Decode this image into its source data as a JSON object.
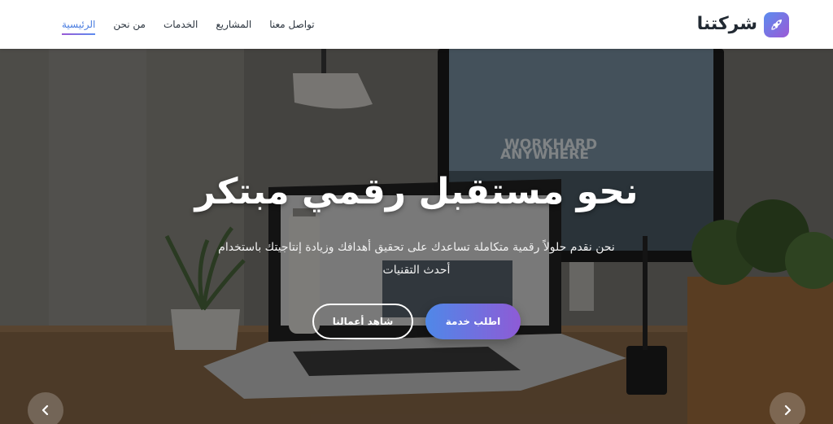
{
  "brand": {
    "name": "شركتنا",
    "logo_icon": "rocket-icon"
  },
  "nav": {
    "items": [
      {
        "label": "الرئيسية",
        "active": true
      },
      {
        "label": "من نحن",
        "active": false
      },
      {
        "label": "الخدمات",
        "active": false
      },
      {
        "label": "المشاريع",
        "active": false
      },
      {
        "label": "تواصل معنا",
        "active": false
      }
    ]
  },
  "hero": {
    "title": "نحو مستقبل رقمي مبتكر",
    "subtitle": "نحن نقدم حلولاً رقمية متكاملة تساعدك على تحقيق أهدافك وزيادة إنتاجيتك باستخدام أحدث التقنيات",
    "primary_button": "اطلب خدمة",
    "secondary_button": "شاهد أعمالنا",
    "monitor_text_line1": "WORKHARD",
    "monitor_text_line2": "ANYWHERE"
  },
  "carousel": {
    "prev_icon": "chevron-left-icon",
    "next_icon": "chevron-right-icon"
  },
  "colors": {
    "accent_start": "#4f88e8",
    "accent_end": "#8e5bd6",
    "nav_active": "#4a7de0",
    "text_dark": "#222a33"
  }
}
